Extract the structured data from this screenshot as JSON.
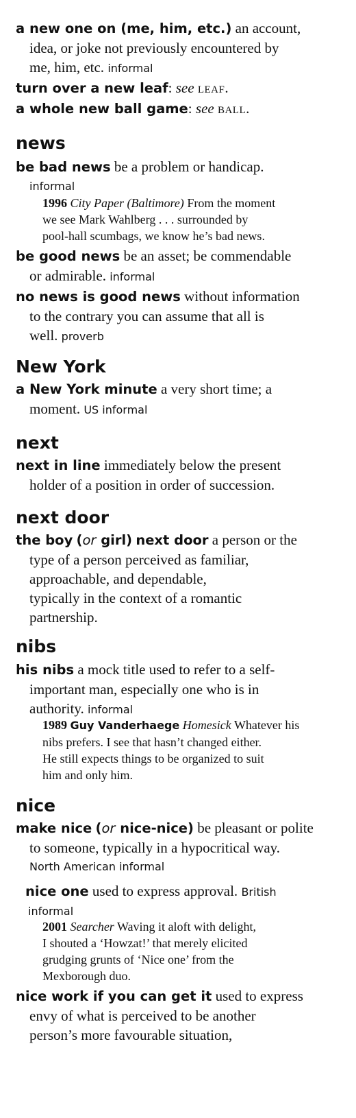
{
  "e1": {
    "phrase": "a new one on (me, him, etc.)",
    "l1": "an account,",
    "l2": "idea, or joke not previously encountered by",
    "l3": "me, him, etc.",
    "label": "informal"
  },
  "e2": {
    "phrase": "turn over a new leaf",
    "colon": ":",
    "see": "see",
    "ref": "LEAF",
    "end": "."
  },
  "e3": {
    "phrase": "a whole new ball game",
    "colon": ":",
    "see": "see",
    "ref": "BALL",
    "end": "."
  },
  "h_news": "news",
  "e4": {
    "phrase": "be bad news",
    "l1": "be a problem or handicap.",
    "label": "informal"
  },
  "q1": {
    "year": "1996",
    "source": "City Paper (Baltimore)",
    "l1": "From the moment",
    "l2": "we see Mark Wahlberg . . .  surrounded by",
    "l3": "pool-hall scumbags, we know he’s bad news."
  },
  "e5": {
    "phrase": "be good news",
    "l1": "be an asset; be commendable",
    "l2": "or admirable.",
    "label": "informal"
  },
  "e6": {
    "phrase": "no news is good news",
    "l1": "without information",
    "l2": "to the contrary you can assume that all is",
    "l3": "well.",
    "label": "proverb"
  },
  "h_newyork": "New York",
  "e7": {
    "phrase": "a New York minute",
    "l1": "a very short time; a",
    "l2": "moment.",
    "label": "US informal"
  },
  "h_next": "next",
  "e8": {
    "phrase": "next in line",
    "l1": "immediately below the present",
    "l2": "holder of a position in order of succession."
  },
  "h_nextdoor": "next door",
  "e9": {
    "p1": "the boy",
    "open": "(",
    "or": "or",
    "p2": "girl)",
    "p3": "next door",
    "l1": "a person or the",
    "l2": "type of a person perceived as familiar,",
    "l3": "approachable, and dependable,",
    "l4": "typically in the context of a romantic",
    "l5": "partnership."
  },
  "h_nibs": "nibs",
  "e10": {
    "phrase": "his nibs",
    "l1": "a mock title used to refer to a self-",
    "l2": "important man, especially one who is in",
    "l3": "authority.",
    "label": "informal"
  },
  "q2": {
    "year": "1989",
    "author": "Guy Vanderhaege",
    "source": "Homesick",
    "l1": "Whatever his",
    "l2": "nibs prefers. I see that hasn’t changed either.",
    "l3": "He still expects things to be organized to suit",
    "l4": "him and only him."
  },
  "h_nice": "nice",
  "e11": {
    "p1": "make nice",
    "open": "(",
    "or": "or",
    "p2": "nice-nice)",
    "l1": "be pleasant or polite",
    "l2": "to someone, typically in a hypocritical way.",
    "label": "North American informal"
  },
  "e12": {
    "phrase": "nice one",
    "l1": "used to express approval.",
    "label1": "British",
    "label2": "informal"
  },
  "q3": {
    "year": "2001",
    "source": "Searcher",
    "l1": "Waving it aloft with delight,",
    "l2": "I shouted a ‘Howzat!’ that merely elicited",
    "l3": "grudging grunts of ‘Nice one’ from the",
    "l4": "Mexborough duo."
  },
  "e13": {
    "phrase": "nice work if you can get it",
    "l1": "used to express",
    "l2": "envy of what is perceived to be another",
    "l3": "person’s more favourable situation,"
  }
}
